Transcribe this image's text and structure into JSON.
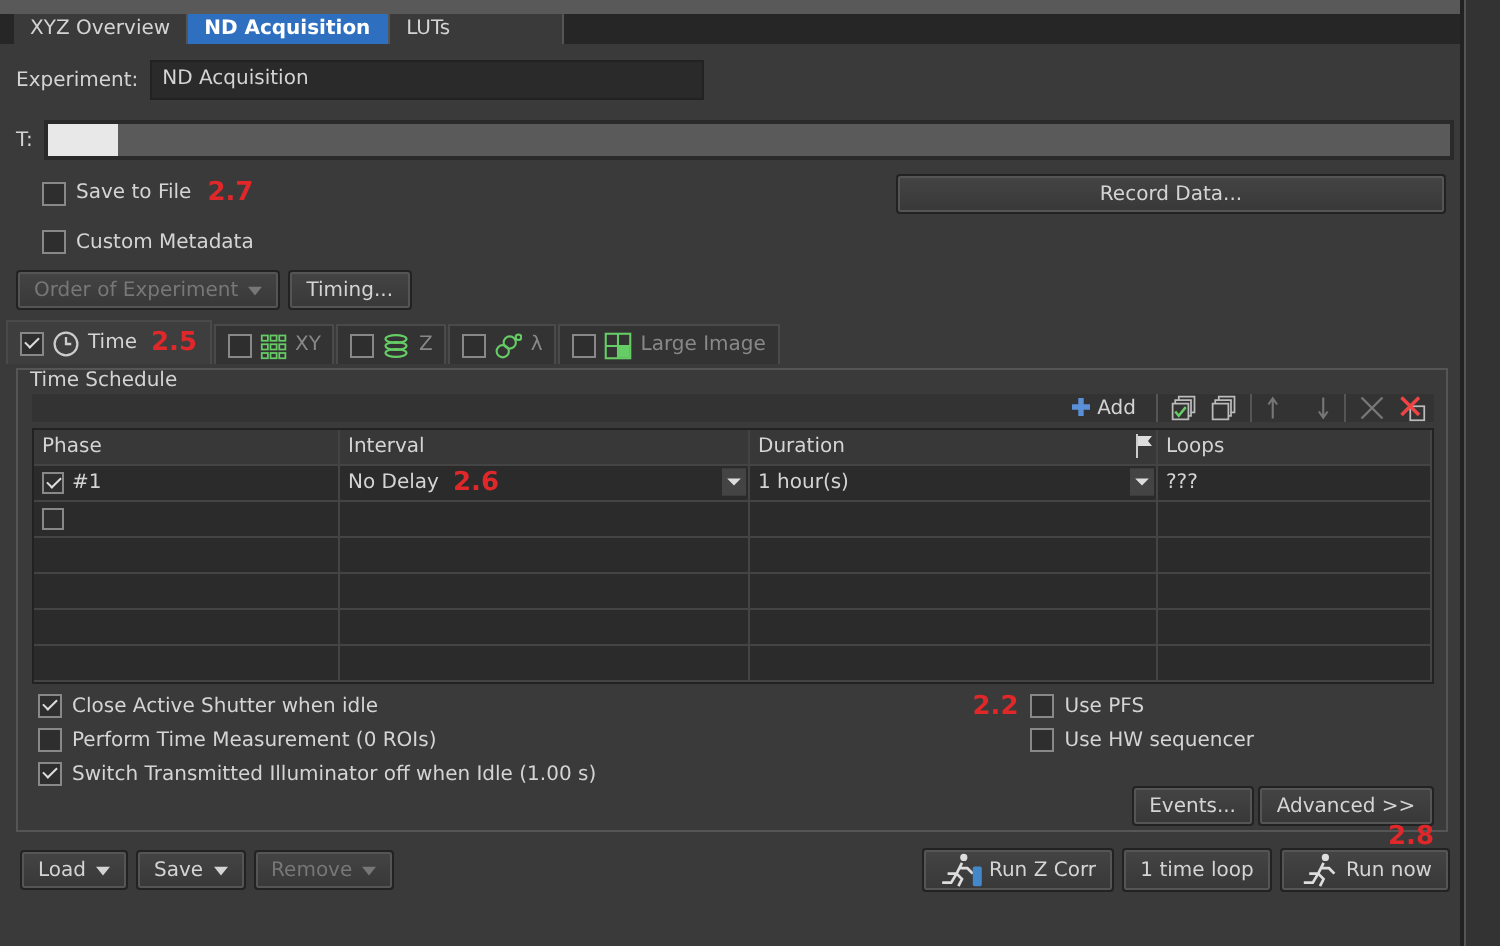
{
  "tabs": [
    {
      "label": "XYZ Overview",
      "selected": false
    },
    {
      "label": "ND Acquisition",
      "selected": true
    },
    {
      "label": "LUTs",
      "selected": false
    }
  ],
  "experiment": {
    "label": "Experiment:",
    "value": "ND Acquisition"
  },
  "t_bar": {
    "label": "T:",
    "level": 0.05
  },
  "options": [
    {
      "label": "Save to File",
      "checked": false,
      "annotation": "2.7"
    },
    {
      "label": "Custom Metadata",
      "checked": false
    }
  ],
  "record_button": "Record Data...",
  "order_dropdown": {
    "label": "Order of Experiment",
    "disabled": true
  },
  "timing_button": "Timing...",
  "dimension_tabs": [
    {
      "label": "Time",
      "kind": "clock",
      "checked": true,
      "selected": true,
      "annotation": "2.5"
    },
    {
      "label": "XY",
      "kind": "grid",
      "checked": false,
      "selected": false
    },
    {
      "label": "Z",
      "kind": "layers",
      "checked": false,
      "selected": false
    },
    {
      "label": "λ",
      "kind": "circles",
      "checked": false,
      "selected": false
    },
    {
      "label": "Large Image",
      "kind": "tiles",
      "checked": false,
      "selected": false
    }
  ],
  "schedule": {
    "title": "Time Schedule",
    "add_label": "Add",
    "columns": [
      "Phase",
      "Interval",
      "Duration",
      "Loops"
    ],
    "rows": [
      {
        "checked": true,
        "phase": "#1",
        "interval": "No Delay",
        "interval_annotation": "2.6",
        "duration": "1 hour(s)",
        "loops": "???"
      },
      {
        "checked": false
      }
    ]
  },
  "left_options": [
    {
      "label": "Close Active Shutter when idle",
      "checked": true
    },
    {
      "label": "Perform Time Measurement (0 ROIs)",
      "checked": false
    },
    {
      "label": "Switch Transmitted Illuminator off when Idle (1.00 s)",
      "checked": true
    }
  ],
  "right_options": [
    {
      "label": "Use PFS",
      "checked": false,
      "annotation": "2.2"
    },
    {
      "label": "Use HW sequencer",
      "checked": false
    }
  ],
  "events_button": "Events...",
  "advanced_button": "Advanced >>",
  "footer_left": [
    {
      "label": "Load",
      "disabled": false
    },
    {
      "label": "Save",
      "disabled": false
    },
    {
      "label": "Remove",
      "disabled": true
    }
  ],
  "run_z_button": "Run Z Corr",
  "loop_button": "1 time loop",
  "run_now": {
    "label": "Run now",
    "annotation": "2.8"
  }
}
